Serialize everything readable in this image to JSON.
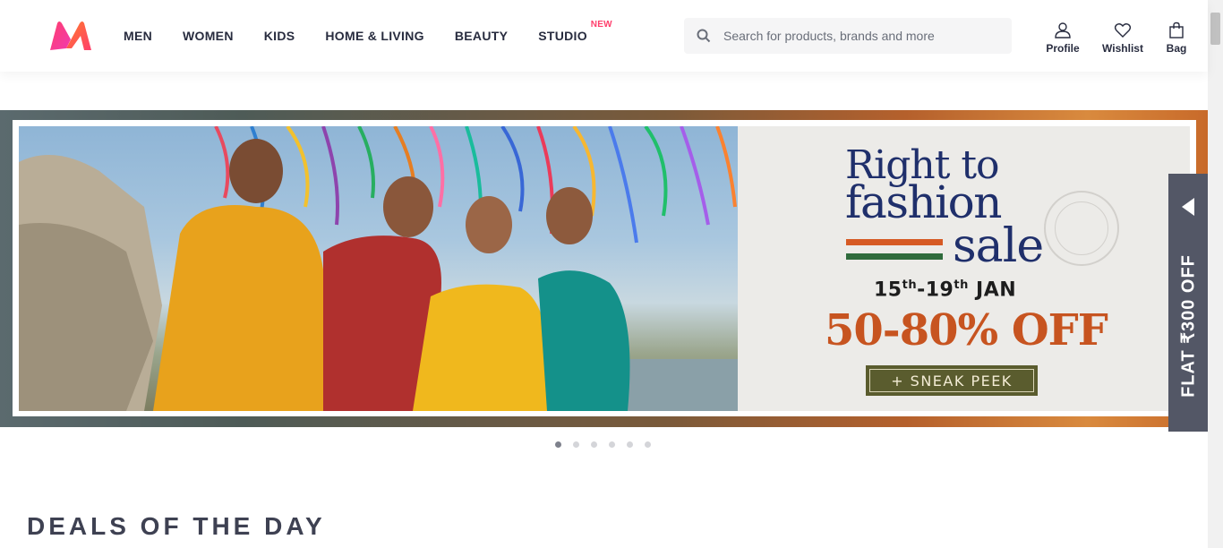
{
  "header": {
    "nav": [
      {
        "label": "MEN"
      },
      {
        "label": "WOMEN"
      },
      {
        "label": "KIDS"
      },
      {
        "label": "HOME & LIVING"
      },
      {
        "label": "BEAUTY"
      },
      {
        "label": "STUDIO"
      }
    ],
    "studio_badge": "NEW",
    "search_placeholder": "Search for products, brands and more",
    "actions": {
      "profile": "Profile",
      "wishlist": "Wishlist",
      "bag": "Bag"
    }
  },
  "banner": {
    "title_line1": "Right to",
    "title_line2": "fashion",
    "title_line3": "sale",
    "dates_day1": "15",
    "dates_sup1": "th",
    "dates_sep": "-19",
    "dates_sup2": "th",
    "dates_month": " JAN",
    "discount": "50-80% OFF",
    "cta": "+ SNEAK PEEK"
  },
  "offer_tab": {
    "text": "FLAT ₹300 OFF"
  },
  "carousel": {
    "total_slides": 6,
    "active_slide": 1
  },
  "sections": {
    "deals_title": "DEALS OF THE DAY"
  },
  "colors": {
    "brand_pink": "#ff3f6c",
    "nav_text": "#282c3f",
    "promo_navy": "#1f2f6b",
    "promo_orange": "#c75420",
    "cta_olive": "#5a5c2e"
  }
}
